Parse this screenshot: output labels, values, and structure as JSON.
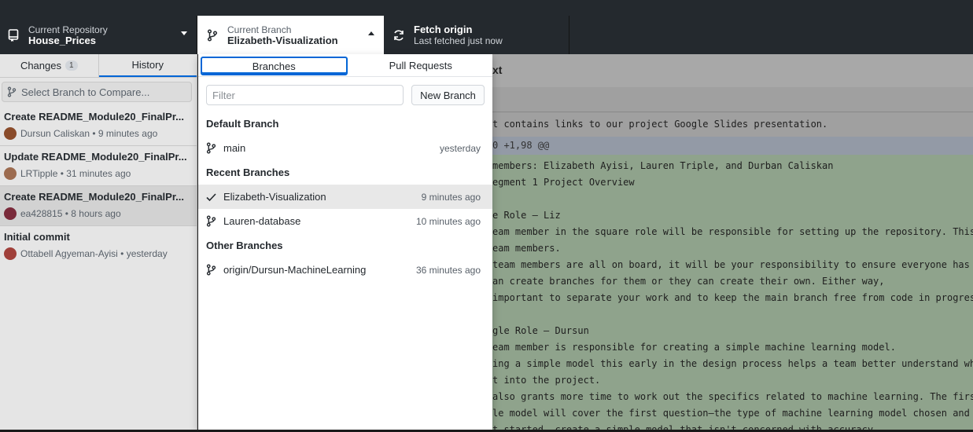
{
  "toolbar": {
    "repo_label": "Current Repository",
    "repo_name": "House_Prices",
    "branch_label": "Current Branch",
    "branch_name": "Elizabeth-Visualization",
    "fetch_title": "Fetch origin",
    "fetch_sub": "Last fetched just now"
  },
  "left": {
    "tab_changes": "Changes",
    "changes_count": "1",
    "tab_history": "History",
    "compare_placeholder": "Select Branch to Compare...",
    "commits": [
      {
        "title": "Create README_Module20_FinalPr...",
        "meta": "Dursun Caliskan • 9 minutes ago",
        "avatar_color": "#8a4b2a"
      },
      {
        "title": "Update README_Module20_FinalPr...",
        "meta": "LRTipple • 31 minutes ago",
        "avatar_color": "#9c6b4f"
      },
      {
        "title": "Create README_Module20_FinalPr...",
        "meta": "ea428815 • 8 hours ago",
        "avatar_color": "#7a2a3a"
      },
      {
        "title": "Initial commit",
        "meta": "Ottabell Agyeman-Ayisi • yesterday",
        "avatar_color": "#a0403a"
      }
    ]
  },
  "dropdown": {
    "tab_branches": "Branches",
    "tab_pulls": "Pull Requests",
    "filter_placeholder": "Filter",
    "new_branch": "New Branch",
    "default_group": "Default Branch",
    "default_items": [
      {
        "name": "main",
        "time": "yesterday"
      }
    ],
    "recent_group": "Recent Branches",
    "recent_items": [
      {
        "name": "Elizabeth-Visualization",
        "time": "9 minutes ago",
        "icon": "check-icon"
      },
      {
        "name": "Lauren-database",
        "time": "10 minutes ago",
        "icon": "branch-icon"
      }
    ],
    "other_group": "Other Branches",
    "other_items": [
      {
        "name": "origin/Dursun-MachineLearning",
        "time": "36 minutes ago"
      }
    ]
  },
  "diff": {
    "header": "xt",
    "context_line": "t contains links to our project Google Slides presentation.",
    "hunk": "0 +1,98 @@",
    "lines": [
      "members: Elizabeth Ayisi, Lauren Triple, and Durban Caliskan",
      "egment 1 Project Overview",
      "",
      "e Role – Liz",
      "eam member in the square role will be responsible for setting up the repository. This incl",
      "eam members.",
      "team members are all on board, it will be your responsibility to ensure everyone has his o",
      "an create branches for them or they can create their own. Either way,",
      "important to separate your work and to keep the main branch free from code in progress.",
      "",
      "gle Role – Dursun",
      "eam member is responsible for creating a simple machine learning model.",
      "ing a simple model this early in the design process helps a team better understand where a",
      "t into the project.",
      "also grants more time to work out the specifics related to machine learning. The first seg",
      "le model will cover the first question—the type of machine learning model chosen and why.",
      "t started, create a simple model that isn't concerned with accuracy."
    ]
  }
}
